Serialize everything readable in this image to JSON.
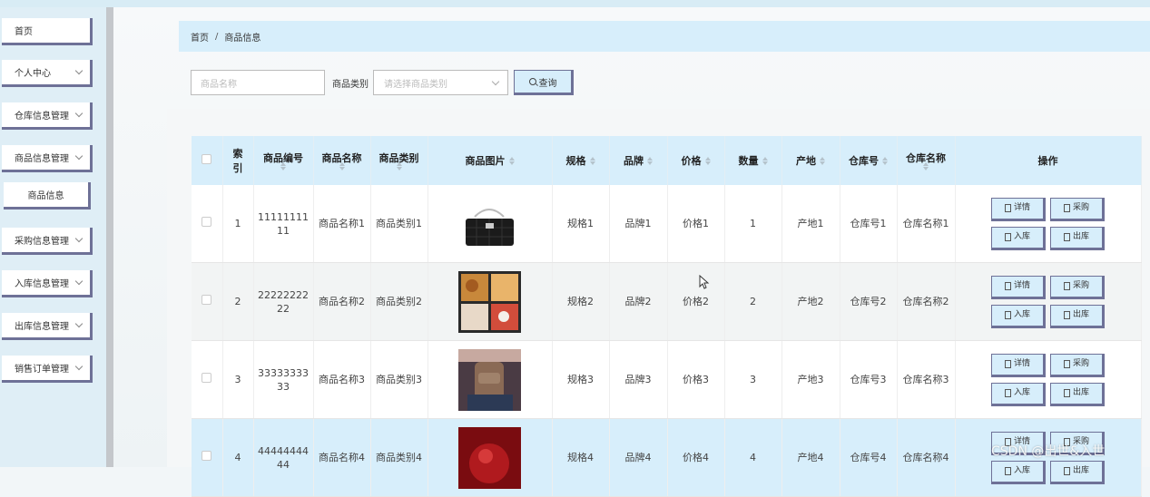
{
  "sidebar": {
    "items": [
      {
        "label": "首页",
        "expandable": false
      },
      {
        "label": "个人中心",
        "expandable": true
      },
      {
        "label": "仓库信息管理",
        "expandable": true
      },
      {
        "label": "商品信息管理",
        "expandable": true
      },
      {
        "label": "商品信息",
        "expandable": false,
        "sub": true
      },
      {
        "label": "采购信息管理",
        "expandable": true
      },
      {
        "label": "入库信息管理",
        "expandable": true
      },
      {
        "label": "出库信息管理",
        "expandable": true
      },
      {
        "label": "销售订单管理",
        "expandable": true
      }
    ]
  },
  "breadcrumb": {
    "home": "首页",
    "separator": "/",
    "current": "商品信息"
  },
  "search": {
    "name_placeholder": "商品名称",
    "category_label": "商品类别",
    "category_placeholder": "请选择商品类别",
    "query_label": "查询"
  },
  "table": {
    "headers": {
      "index_1": "索",
      "index_2": "引",
      "code": "商品编号",
      "name": "商品名称",
      "category": "商品类别",
      "image": "商品图片",
      "spec": "规格",
      "brand": "品牌",
      "price": "价格",
      "qty": "数量",
      "origin": "产地",
      "warehouse_no": "仓库号",
      "warehouse_name": "仓库名称",
      "ops": "操作"
    },
    "actions": {
      "detail": "详情",
      "purchase": "采购",
      "stock_in": "入库",
      "stock_out": "出库"
    },
    "rows": [
      {
        "index": "1",
        "code": "1111111111",
        "name": "商品名称1",
        "category": "商品类别1",
        "spec": "规格1",
        "brand": "品牌1",
        "price": "价格1",
        "qty": "1",
        "origin": "产地1",
        "warehouse_no": "仓库号1",
        "warehouse_name": "仓库名称1",
        "image": "black-handbag"
      },
      {
        "index": "2",
        "code": "2222222222",
        "name": "商品名称2",
        "category": "商品类别2",
        "spec": "规格2",
        "brand": "品牌2",
        "price": "价格2",
        "qty": "2",
        "origin": "产地2",
        "warehouse_no": "仓库号2",
        "warehouse_name": "仓库名称2",
        "image": "bento-box"
      },
      {
        "index": "3",
        "code": "3333333333",
        "name": "商品名称3",
        "category": "商品类别3",
        "spec": "规格3",
        "brand": "品牌3",
        "price": "价格3",
        "qty": "3",
        "origin": "产地3",
        "warehouse_no": "仓库号3",
        "warehouse_name": "仓库名称3",
        "image": "brown-backpack"
      },
      {
        "index": "4",
        "code": "4444444444",
        "name": "商品名称4",
        "category": "商品类别4",
        "spec": "规格4",
        "brand": "品牌4",
        "price": "价格4",
        "qty": "4",
        "origin": "产地4",
        "warehouse_no": "仓库号4",
        "warehouse_name": "仓库名称4",
        "image": "red-product"
      }
    ]
  },
  "watermark": "CSDN @出世&入世",
  "colors": {
    "accent": "#d7eefb",
    "button_border": "#6e7197",
    "sidebar_bg": "#dfeef6"
  }
}
